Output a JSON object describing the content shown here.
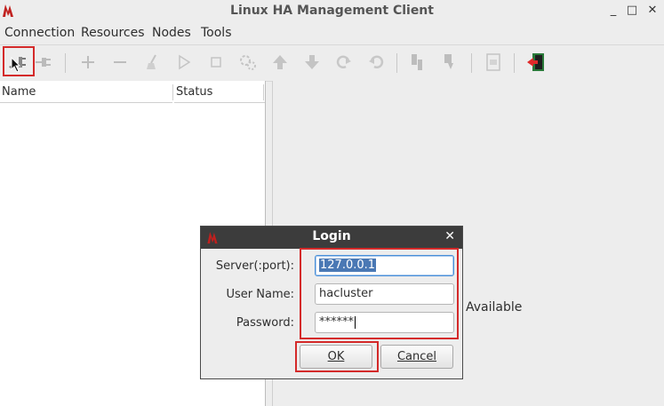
{
  "window": {
    "title": "Linux HA Management Client",
    "minimize_glyph": "_",
    "maximize_glyph": "□",
    "close_glyph": "✕"
  },
  "menu": [
    {
      "label": "Connection"
    },
    {
      "label": "Resources"
    },
    {
      "label": "Nodes"
    },
    {
      "label": "Tools"
    }
  ],
  "toolbar": {
    "icons": [
      "login-icon",
      "logout-icon",
      "add-icon",
      "remove-icon",
      "cleanup-icon",
      "start-icon",
      "stop-icon",
      "configure-icon",
      "move-up-icon",
      "move-down-icon",
      "redo-icon",
      "undo-icon",
      "standby-icon",
      "active-icon",
      "view-xml-icon",
      "exit-icon"
    ]
  },
  "tree": {
    "columns": [
      "Name",
      "Status"
    ]
  },
  "right_pane": {
    "status_text": "Available"
  },
  "login_dialog": {
    "title": "Login",
    "close_glyph": "✕",
    "server_label": "Server(:port):",
    "server_value": "127.0.0.1",
    "username_label": "User Name:",
    "username_value": "hacluster",
    "password_label": "Password:",
    "password_value": "******",
    "ok_label": "OK",
    "cancel_label": "Cancel"
  },
  "colors": {
    "highlight": "#d42a2a",
    "selection": "#4a78b4",
    "dialog_title_bg": "#3c3c3c"
  }
}
